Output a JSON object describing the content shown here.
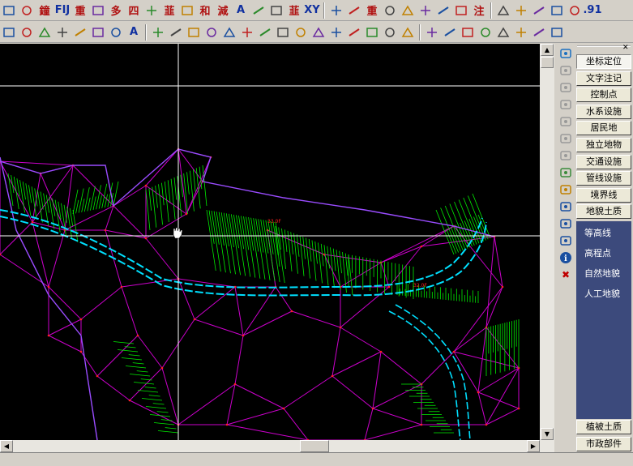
{
  "toolbar_top": [
    {
      "icon": "palette-icon"
    },
    {
      "icon": "cross-box-icon"
    },
    {
      "text": "鐘"
    },
    {
      "text": "FIJ"
    },
    {
      "text": "重"
    },
    {
      "icon": "dash-icon"
    },
    {
      "text": "多"
    },
    {
      "text": "四"
    },
    {
      "icon": "double-dash-icon"
    },
    {
      "text": "韮"
    },
    {
      "icon": "bracket-icon"
    },
    {
      "text": "和"
    },
    {
      "text": "減"
    },
    {
      "text": "A"
    },
    {
      "icon": "pattern-icon"
    },
    {
      "icon": "hatch-icon"
    },
    {
      "text": "韮"
    },
    {
      "text": "XY"
    },
    {
      "icon": "arrow-tag-icon"
    },
    {
      "icon": "hatch-tag-icon"
    },
    {
      "text": "重"
    },
    {
      "icon": "shuffle-icon"
    },
    {
      "icon": "eye-icon"
    },
    {
      "icon": "grid-cross-icon"
    },
    {
      "icon": "chart-icon"
    },
    {
      "icon": "ruler-icon"
    },
    {
      "text": "注"
    },
    {
      "icon": "corner-icon"
    },
    {
      "icon": "rect-icon"
    },
    {
      "icon": "long-rect-icon"
    },
    {
      "icon": "lines-icon"
    },
    {
      "icon": "squiggle-icon"
    },
    {
      "text": ".91"
    }
  ],
  "toolbar_bottom": [
    {
      "icon": "ellipse-icon"
    },
    {
      "icon": "undo-icon"
    },
    {
      "icon": "redo-icon"
    },
    {
      "icon": "pin-icon"
    },
    {
      "icon": "dot-icon"
    },
    {
      "icon": "grid-select-icon"
    },
    {
      "icon": "shape-icon"
    },
    {
      "text": "A"
    },
    {
      "icon": "pencil-icon"
    },
    {
      "icon": "chain-icon"
    },
    {
      "icon": "mirror-icon"
    },
    {
      "icon": "blocks-icon"
    },
    {
      "icon": "move-icon"
    },
    {
      "icon": "rotate-icon"
    },
    {
      "icon": "scale-icon"
    },
    {
      "icon": "mirror2-icon"
    },
    {
      "icon": "break-icon"
    },
    {
      "icon": "dashed-line-icon"
    },
    {
      "icon": "box-icon"
    },
    {
      "icon": "box2-icon"
    },
    {
      "icon": "angle-icon"
    },
    {
      "icon": "angle2-icon"
    },
    {
      "icon": "spark-icon"
    },
    {
      "icon": "layers-icon"
    },
    {
      "icon": "zoom-icon"
    },
    {
      "icon": "leaf-icon"
    },
    {
      "icon": "leaf2-icon"
    },
    {
      "icon": "camera-icon"
    },
    {
      "icon": "export-icon"
    },
    {
      "icon": "folder-icon"
    },
    {
      "icon": "plugin-icon"
    }
  ],
  "panel": {
    "items": [
      {
        "label": "坐标定位",
        "selected": true
      },
      {
        "label": "文字注记"
      },
      {
        "label": "控制点"
      },
      {
        "label": "水系设施"
      },
      {
        "label": "居民地"
      },
      {
        "label": "独立地物"
      },
      {
        "label": "交通设施"
      },
      {
        "label": "管线设施"
      },
      {
        "label": "境界线"
      },
      {
        "label": "地貌土质"
      }
    ],
    "sub_items": [
      "等高线",
      "高程点",
      "自然地貌",
      "人工地貌"
    ],
    "bottom_items": [
      "植被土质",
      "市政部件"
    ]
  },
  "side_icons": [
    "layers-icon",
    "zoom-in-icon",
    "zoom-out-icon",
    "pan-icon",
    "zoom-window-icon",
    "zoom-prev-icon",
    "redraw-icon",
    "node-icon",
    "pen-icon",
    "tag-icon",
    "refresh-icon",
    "calc-icon",
    "info-icon",
    "delete-icon"
  ],
  "canvas_labels": [
    "33.0F",
    "32.0F"
  ],
  "colors": {
    "background": "#000000",
    "tin": "#cc00cc",
    "slope": "#00ee00",
    "road": "#00e0ff",
    "crosshair": "#ffffff",
    "label": "#ff2020"
  }
}
